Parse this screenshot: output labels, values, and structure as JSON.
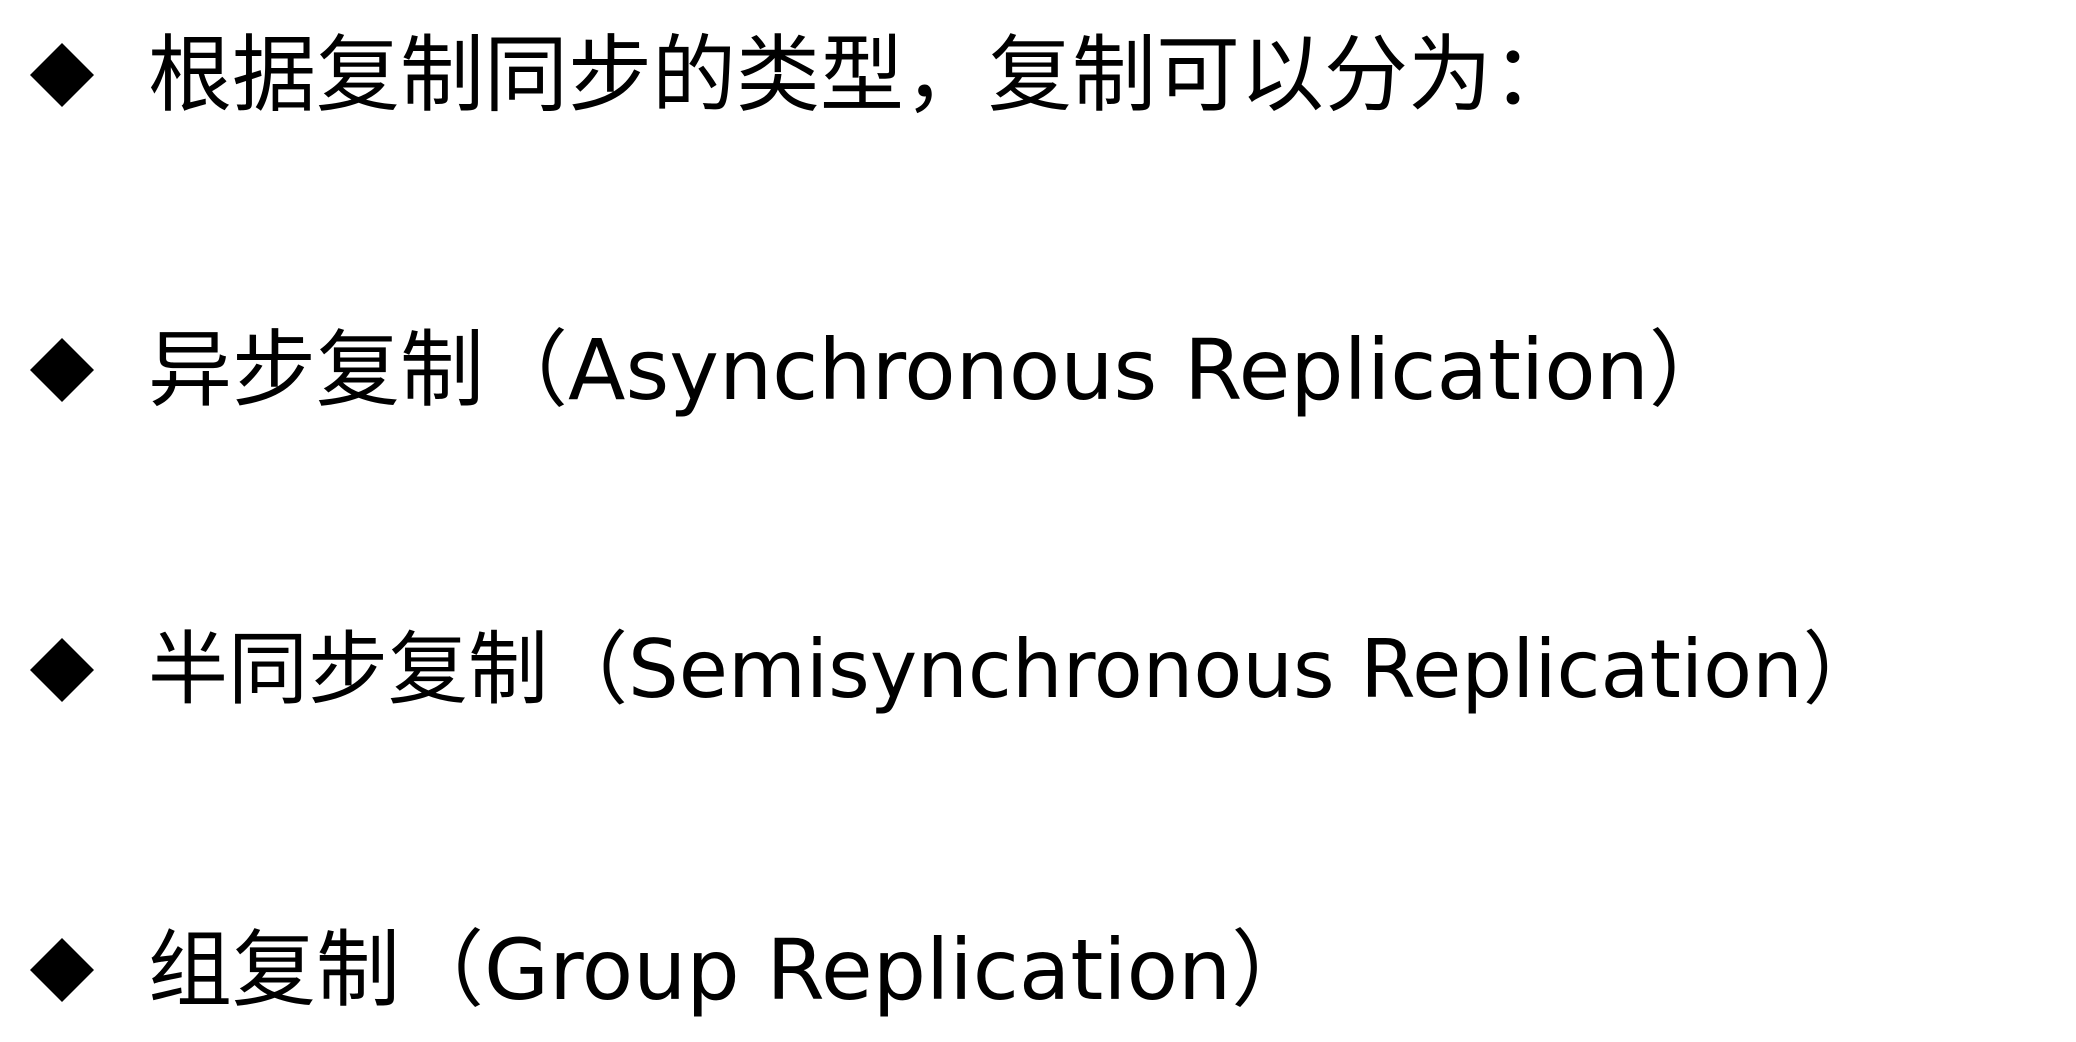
{
  "bullets": [
    {
      "icon": "diamond-bullet-icon",
      "text": "根据复制同步的类型，复制可以分为："
    },
    {
      "icon": "diamond-bullet-icon",
      "text": "异步复制（Asynchronous Replication）"
    },
    {
      "icon": "diamond-bullet-icon",
      "text": "半同步复制（Semisynchronous Replication）"
    },
    {
      "icon": "diamond-bullet-icon",
      "text": "组复制（Group Replication）"
    }
  ],
  "colors": {
    "text": "#000000",
    "background": "#ffffff",
    "bullet": "#000000"
  }
}
